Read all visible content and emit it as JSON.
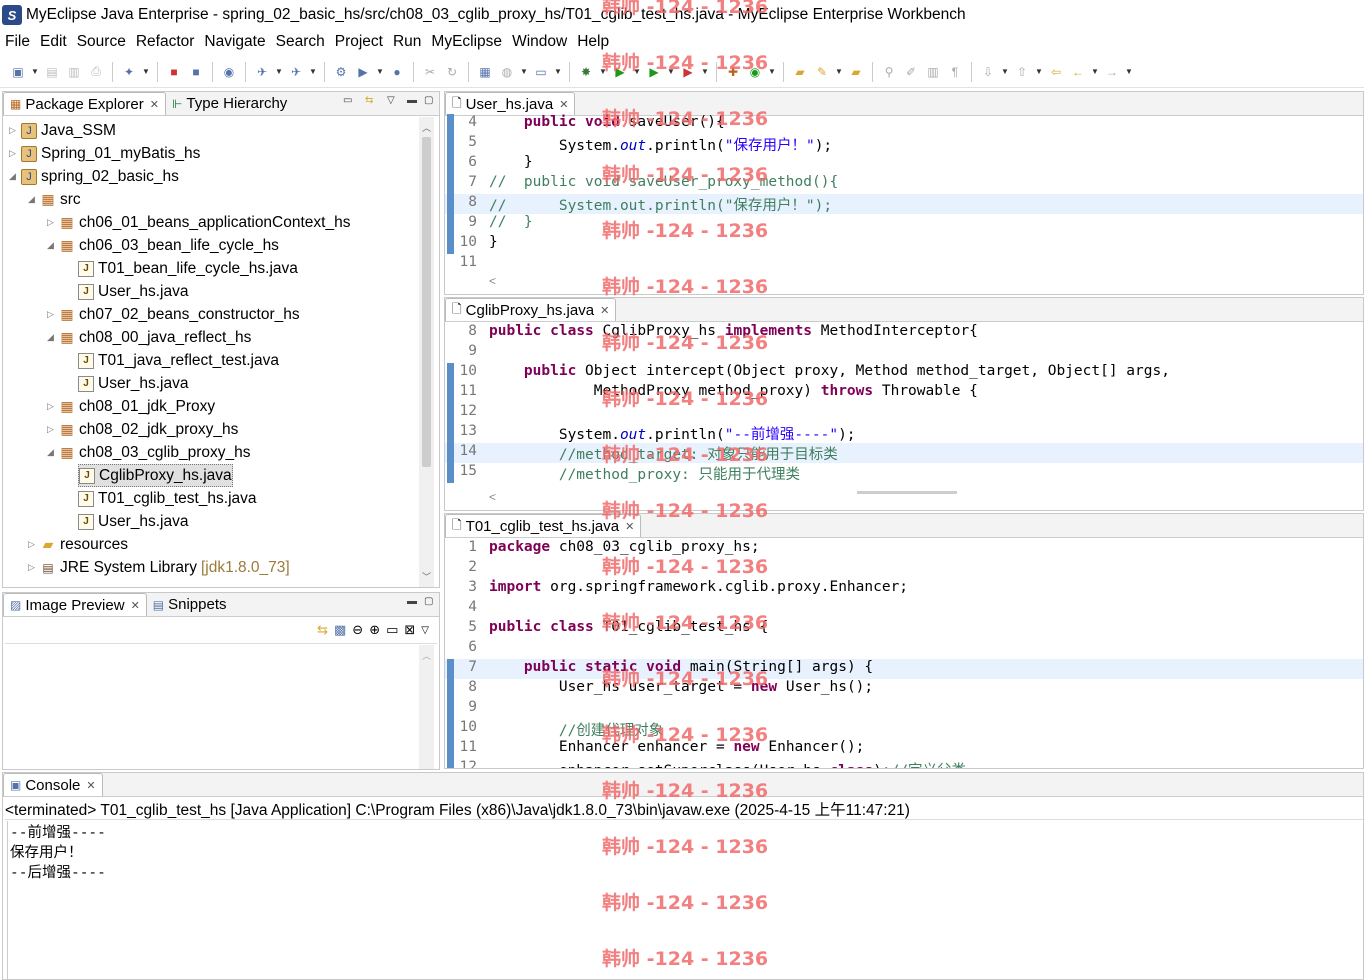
{
  "window": {
    "title": "MyEclipse Java Enterprise - spring_02_basic_hs/src/ch08_03_cglib_proxy_hs/T01_cglib_test_hs.java - MyEclipse Enterprise Workbench",
    "app_icon": "S"
  },
  "menu": [
    "File",
    "Edit",
    "Source",
    "Refactor",
    "Navigate",
    "Search",
    "Project",
    "Run",
    "MyEclipse",
    "Window",
    "Help"
  ],
  "package_explorer": {
    "tabs": [
      {
        "label": "Package Explorer",
        "active": true
      },
      {
        "label": "Type Hierarchy",
        "active": false
      }
    ],
    "tree": [
      {
        "label": "Java_SSM",
        "icon": "project-icon",
        "depth": 0
      },
      {
        "label": "Spring_01_myBatis_hs",
        "icon": "project-icon",
        "depth": 0
      },
      {
        "label": "spring_02_basic_hs",
        "icon": "project-icon",
        "depth": 0,
        "expanded": true
      },
      {
        "label": "src",
        "icon": "source-folder-icon",
        "depth": 1,
        "expanded": true
      },
      {
        "label": "ch06_01_beans_applicationContext_hs",
        "icon": "package-icon",
        "depth": 2
      },
      {
        "label": "ch06_03_bean_life_cycle_hs",
        "icon": "package-icon",
        "depth": 2,
        "expanded": true
      },
      {
        "label": "T01_bean_life_cycle_hs.java",
        "icon": "java-file-icon",
        "depth": 3
      },
      {
        "label": "User_hs.java",
        "icon": "java-file-icon",
        "depth": 3
      },
      {
        "label": "ch07_02_beans_constructor_hs",
        "icon": "package-icon",
        "depth": 2
      },
      {
        "label": "ch08_00_java_reflect_hs",
        "icon": "package-icon",
        "depth": 2,
        "expanded": true
      },
      {
        "label": "T01_java_reflect_test.java",
        "icon": "java-file-icon",
        "depth": 3
      },
      {
        "label": "User_hs.java",
        "icon": "java-file-icon",
        "depth": 3
      },
      {
        "label": "ch08_01_jdk_Proxy",
        "icon": "package-icon",
        "depth": 2
      },
      {
        "label": "ch08_02_jdk_proxy_hs",
        "icon": "package-icon",
        "depth": 2
      },
      {
        "label": "ch08_03_cglib_proxy_hs",
        "icon": "package-icon",
        "depth": 2,
        "expanded": true
      },
      {
        "label": "CglibProxy_hs.java",
        "icon": "java-file-icon",
        "depth": 3,
        "selected": true
      },
      {
        "label": "T01_cglib_test_hs.java",
        "icon": "java-file-icon",
        "depth": 3
      },
      {
        "label": "User_hs.java",
        "icon": "java-file-icon",
        "depth": 3
      },
      {
        "label": "resources",
        "icon": "folder-icon",
        "depth": 1
      },
      {
        "label": "JRE System Library",
        "suffix": "[jdk1.8.0_73]",
        "icon": "library-icon",
        "depth": 1
      }
    ]
  },
  "image_preview": {
    "tabs": [
      {
        "label": "Image Preview",
        "active": true
      },
      {
        "label": "Snippets",
        "active": false
      }
    ]
  },
  "editors": {
    "user_hs": {
      "tab": "User_hs.java",
      "lines": [
        {
          "n": "4",
          "t": "    public void saveUser(){"
        },
        {
          "n": "5",
          "t": "        System.out.println(\"保存用户！\");"
        },
        {
          "n": "6",
          "t": "    }"
        },
        {
          "n": "7",
          "t": "//  public void saveUser_proxy_method(){"
        },
        {
          "n": "8",
          "t": "//      System.out.println(\"保存用户！\");"
        },
        {
          "n": "9",
          "t": "//  }"
        },
        {
          "n": "10",
          "t": "}"
        },
        {
          "n": "11",
          "t": ""
        }
      ]
    },
    "cglib_proxy": {
      "tab": "CglibProxy_hs.java",
      "lines": [
        {
          "n": "8",
          "t": "public class CglibProxy_hs implements MethodInterceptor{"
        },
        {
          "n": "9",
          "t": ""
        },
        {
          "n": "10",
          "t": "    public Object intercept(Object proxy, Method method_target, Object[] args,"
        },
        {
          "n": "11",
          "t": "            MethodProxy method_proxy) throws Throwable {"
        },
        {
          "n": "12",
          "t": ""
        },
        {
          "n": "13",
          "t": "        System.out.println(\"--前增强----\");"
        },
        {
          "n": "14",
          "t": "        //method_target: 对象只能用于目标类"
        },
        {
          "n": "15",
          "t": "        //method_proxy: 只能用于代理类"
        }
      ]
    },
    "cglib_test": {
      "tab": "T01_cglib_test_hs.java",
      "lines": [
        {
          "n": "1",
          "t": "package ch08_03_cglib_proxy_hs;"
        },
        {
          "n": "2",
          "t": ""
        },
        {
          "n": "3",
          "t": "import org.springframework.cglib.proxy.Enhancer;"
        },
        {
          "n": "4",
          "t": ""
        },
        {
          "n": "5",
          "t": "public class T01_cglib_test_hs {"
        },
        {
          "n": "6",
          "t": ""
        },
        {
          "n": "7",
          "t": "    public static void main(String[] args) {"
        },
        {
          "n": "8",
          "t": "        User_hs user_target = new User_hs();"
        },
        {
          "n": "9",
          "t": ""
        },
        {
          "n": "10",
          "t": "        //创建代理对象"
        },
        {
          "n": "11",
          "t": "        Enhancer enhancer = new Enhancer();"
        },
        {
          "n": "12",
          "t": "        enhancer.setSuperclass(User_hs.class);//定义父类"
        }
      ]
    }
  },
  "console": {
    "tab": "Console",
    "header": "<terminated> T01_cglib_test_hs [Java Application] C:\\Program Files (x86)\\Java\\jdk1.8.0_73\\bin\\javaw.exe (2025-4-15 上午11:47:21)",
    "output": [
      "--前增强----",
      "保存用户！",
      "--后增强----"
    ]
  },
  "watermark": "韩帅 -124 - 1236"
}
